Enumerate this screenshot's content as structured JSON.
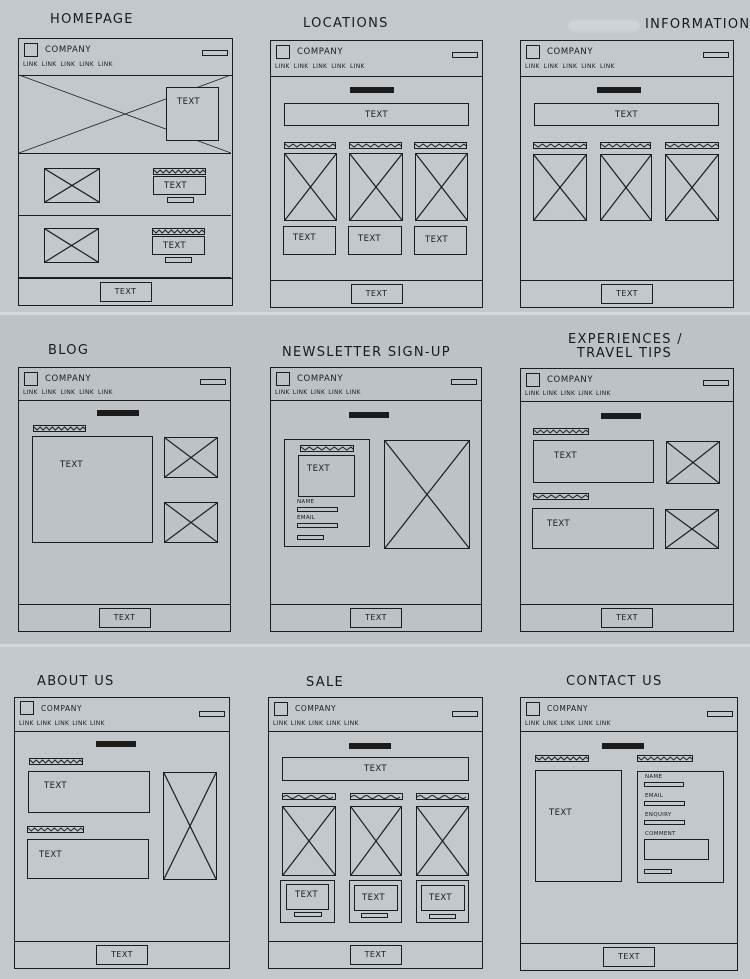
{
  "sheet": {
    "description": "Hand-drawn website wireframe sketches, 9 pages in a 3x3 grid",
    "colors": {
      "paper": "#c3c8cc",
      "ink": "#1d1d1d"
    }
  },
  "common": {
    "company": "COMPANY",
    "nav_links": [
      "LINK",
      "LINK",
      "LINK",
      "LINK",
      "LINK"
    ],
    "footer_button": "TEXT",
    "placeholder_text": "TEXT"
  },
  "pages": {
    "homepage": {
      "title": "Homepage",
      "hero_text": "TEXT",
      "rows": [
        {
          "text": "TEXT"
        },
        {
          "text": "TEXT"
        }
      ]
    },
    "locations": {
      "title": "Locations",
      "banner_text": "TEXT",
      "cards": [
        {
          "text": "TEXT"
        },
        {
          "text": "TEXT"
        },
        {
          "text": "TEXT"
        }
      ]
    },
    "information": {
      "title": "Information",
      "banner_text": "TEXT"
    },
    "blog": {
      "title": "Blog",
      "post_text": "TEXT"
    },
    "newsletter": {
      "title": "Newsletter Sign-up",
      "intro_text": "TEXT",
      "fields": [
        {
          "label": "NAME"
        },
        {
          "label": "EMAIL"
        }
      ]
    },
    "experiences": {
      "title_line1": "Experiences /",
      "title_line2": "Travel Tips",
      "items": [
        {
          "text": "TEXT"
        },
        {
          "text": "TEXT"
        }
      ]
    },
    "about": {
      "title": "About us",
      "sections": [
        {
          "text": "TEXT"
        },
        {
          "text": "TEXT"
        }
      ]
    },
    "sale": {
      "title": "Sale",
      "banner_text": "TEXT",
      "products": [
        {
          "text": "TEXT"
        },
        {
          "text": "TEXT"
        },
        {
          "text": "TEXT"
        }
      ]
    },
    "contact": {
      "title": "Contact us",
      "info_text": "TEXT",
      "fields": [
        {
          "label": "NAME"
        },
        {
          "label": "EMAIL"
        },
        {
          "label": "ENQUIRY"
        },
        {
          "label": "COMMENT"
        }
      ]
    }
  }
}
